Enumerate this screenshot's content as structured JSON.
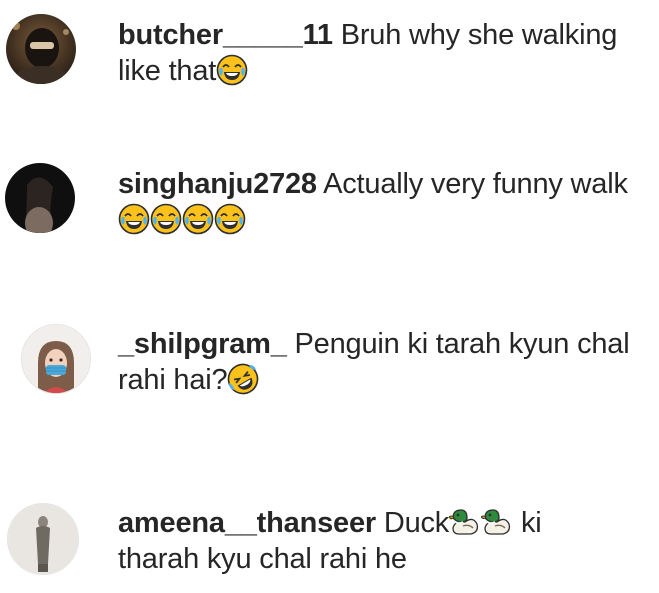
{
  "comments": [
    {
      "username": "butcher_____11",
      "text_line1": " Bruh why she walking",
      "text_line2": "like that",
      "emoji": [
        "joy-emoji"
      ]
    },
    {
      "username": "singhanju2728",
      "text_line1": " Actually very funny walk",
      "text_line2": "",
      "emoji": [
        "joy-emoji",
        "joy-emoji",
        "joy-emoji",
        "joy-emoji"
      ]
    },
    {
      "username": "_shilpgram_",
      "text_line1": " Penguin ki tarah kyun chal",
      "text_line2": "rahi hai?",
      "emoji": [
        "rofl-emoji"
      ]
    },
    {
      "username": "ameena__thanseer",
      "text_line1": " Duck",
      "text_line1_after": " ki",
      "text_line2": "tharah kyu chal rahi he",
      "emoji": [
        "duck-emoji",
        "duck-emoji"
      ]
    }
  ]
}
